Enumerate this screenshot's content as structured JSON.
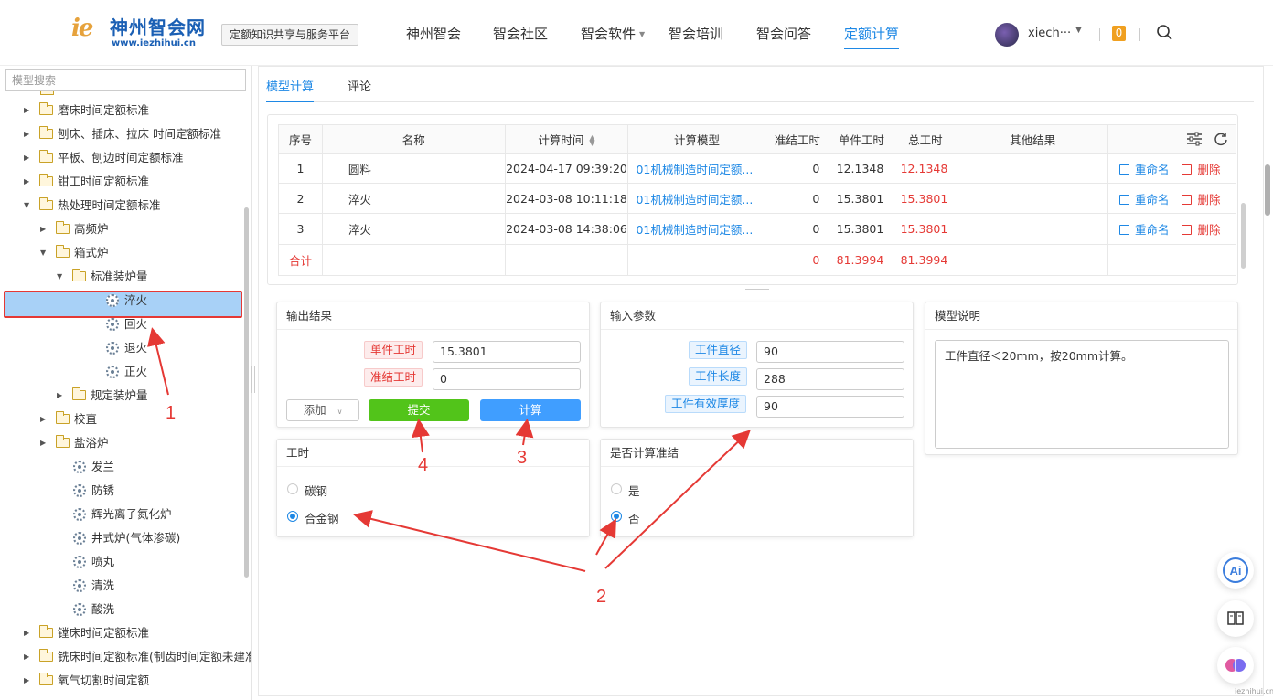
{
  "header": {
    "logo_mark": "ie",
    "logo_text": "神州智会网",
    "logo_url": "www.iezhihui.cn",
    "platform_label": "定额知识共享与服务平台",
    "nav": [
      {
        "label": "神州智会"
      },
      {
        "label": "智会社区"
      },
      {
        "label": "智会软件"
      },
      {
        "label": "智会培训"
      },
      {
        "label": "智会问答"
      },
      {
        "label": "定额计算",
        "active": true
      }
    ],
    "username": "xiech···",
    "notification_count": "0"
  },
  "sidebar": {
    "search_placeholder": "模型搜索",
    "tree": [
      {
        "label": "磨床时间定额标准"
      },
      {
        "label": "刨床、插床、拉床 时间定额标准"
      },
      {
        "label": "平板、刨边时间定额标准"
      },
      {
        "label": "钳工时间定额标准"
      },
      {
        "label": "热处理时间定额标准"
      },
      {
        "label": "高频炉"
      },
      {
        "label": "箱式炉"
      },
      {
        "label": "标准装炉量"
      },
      {
        "label": "淬火"
      },
      {
        "label": "回火"
      },
      {
        "label": "退火"
      },
      {
        "label": "正火"
      },
      {
        "label": "规定装炉量"
      },
      {
        "label": "校直"
      },
      {
        "label": "盐浴炉"
      },
      {
        "label": "发兰"
      },
      {
        "label": "防锈"
      },
      {
        "label": "辉光离子氮化炉"
      },
      {
        "label": "井式炉(气体渗碳)"
      },
      {
        "label": "喷丸"
      },
      {
        "label": "清洗"
      },
      {
        "label": "酸洗"
      },
      {
        "label": "镗床时间定额标准"
      },
      {
        "label": "铣床时间定额标准(制齿时间定额未建准"
      },
      {
        "label": "氧气切割时间定额"
      }
    ]
  },
  "tabs": [
    {
      "label": "模型计算",
      "active": true
    },
    {
      "label": "评论"
    }
  ],
  "table": {
    "headers": [
      "序号",
      "名称",
      "计算时间",
      "计算模型",
      "准结工时",
      "单件工时",
      "总工时",
      "其他结果"
    ],
    "rows": [
      {
        "index": "1",
        "name": "圆料",
        "time": "2024-04-17 09:39:20",
        "model": "01机械制造时间定额...",
        "prep": "0",
        "unit": "12.1348",
        "total": "12.1348"
      },
      {
        "index": "2",
        "name": "淬火",
        "time": "2024-03-08 10:11:18",
        "model": "01机械制造时间定额...",
        "prep": "0",
        "unit": "15.3801",
        "total": "15.3801"
      },
      {
        "index": "3",
        "name": "淬火",
        "time": "2024-03-08 14:38:06",
        "model": "01机械制造时间定额...",
        "prep": "0",
        "unit": "15.3801",
        "total": "15.3801"
      }
    ],
    "rename_label": "重命名",
    "delete_label": "删除",
    "sum": {
      "label": "合计",
      "prep": "0",
      "unit": "81.3994",
      "total": "81.3994"
    }
  },
  "output_panel": {
    "title": "输出结果",
    "unit_label": "单件工时",
    "unit_value": "15.3801",
    "prep_label": "准结工时",
    "prep_value": "0",
    "add_label": "添加",
    "submit_label": "提交",
    "calc_label": "计算"
  },
  "input_panel": {
    "title": "输入参数",
    "params": [
      {
        "label": "工件直径",
        "value": "90"
      },
      {
        "label": "工件长度",
        "value": "288"
      },
      {
        "label": "工件有效厚度",
        "value": "90"
      }
    ]
  },
  "desc_panel": {
    "title": "模型说明",
    "text": "工件直径＜20mm，按20mm计算。"
  },
  "worktime_panel": {
    "title": "工时",
    "options": [
      {
        "label": "碳钢",
        "selected": false
      },
      {
        "label": "合金钢",
        "selected": true
      }
    ]
  },
  "prep_panel": {
    "title": "是否计算准结",
    "options": [
      {
        "label": "是",
        "selected": false
      },
      {
        "label": "否",
        "selected": true
      }
    ]
  },
  "annotations": [
    "1",
    "2",
    "3",
    "4"
  ],
  "watermark": "iezhihui.cn",
  "colors": {
    "accent": "#1e88e5",
    "danger": "#e53935",
    "submit": "#52c41a",
    "calc": "#409eff",
    "selection": "#a8d1f7"
  }
}
